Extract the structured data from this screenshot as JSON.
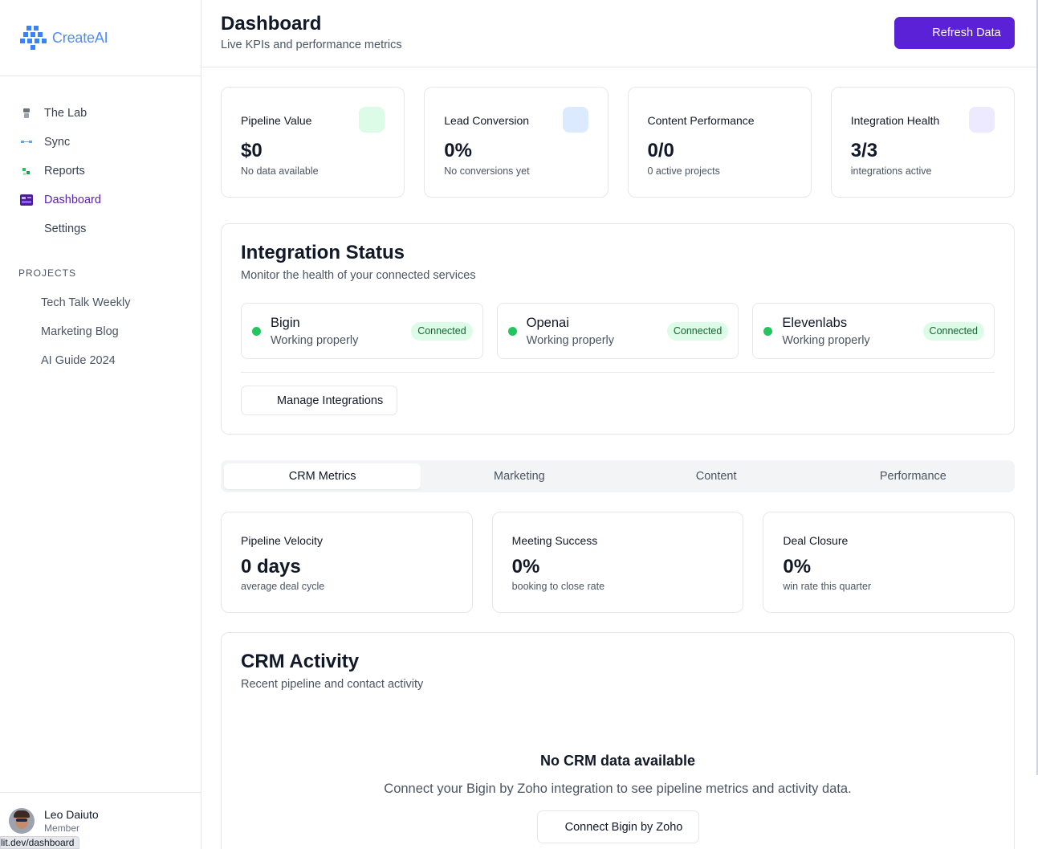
{
  "brand": {
    "name": "CreateAI",
    "color": "#3b82f6"
  },
  "sidebar": {
    "nav": [
      {
        "label": "The Lab",
        "icon": "lab-icon",
        "active": false
      },
      {
        "label": "Sync",
        "icon": "sync-icon",
        "active": false
      },
      {
        "label": "Reports",
        "icon": "reports-icon",
        "active": false
      },
      {
        "label": "Dashboard",
        "icon": "dashboard-icon",
        "active": true
      },
      {
        "label": "Settings",
        "icon": "",
        "active": false
      }
    ],
    "projects_title": "PROJECTS",
    "projects": [
      "Tech Talk Weekly",
      "Marketing Blog",
      "AI Guide 2024"
    ],
    "user": {
      "name": "Leo Daiuto",
      "role": "Member"
    },
    "status_url": "lit.dev/dashboard"
  },
  "header": {
    "title": "Dashboard",
    "subtitle": "Live KPIs and performance metrics",
    "refresh_label": "Refresh Data",
    "accent": "#5b21d6"
  },
  "kpis": [
    {
      "label": "Pipeline Value",
      "value": "$0",
      "note": "No data available",
      "swatch": "#dcfce7"
    },
    {
      "label": "Lead Conversion",
      "value": "0%",
      "note": "No conversions yet",
      "swatch": "#dbeafe"
    },
    {
      "label": "Content Performance",
      "value": "0/0",
      "note": "0 active projects",
      "swatch": ""
    },
    {
      "label": "Integration Health",
      "value": "3/3",
      "note": "integrations active",
      "swatch": "#ede9fe"
    }
  ],
  "integrations": {
    "title": "Integration Status",
    "subtitle": "Monitor the health of your connected services",
    "items": [
      {
        "name": "Bigin",
        "state": "Working properly",
        "badge": "Connected"
      },
      {
        "name": "Openai",
        "state": "Working properly",
        "badge": "Connected"
      },
      {
        "name": "Elevenlabs",
        "state": "Working properly",
        "badge": "Connected"
      }
    ],
    "manage_label": "Manage Integrations",
    "status_color": "#22c55e"
  },
  "tabs": [
    {
      "label": "CRM Metrics",
      "active": true
    },
    {
      "label": "Marketing",
      "active": false
    },
    {
      "label": "Content",
      "active": false
    },
    {
      "label": "Performance",
      "active": false
    }
  ],
  "metrics": [
    {
      "label": "Pipeline Velocity",
      "value": "0 days",
      "note": "average deal cycle"
    },
    {
      "label": "Meeting Success",
      "value": "0%",
      "note": "booking to close rate"
    },
    {
      "label": "Deal Closure",
      "value": "0%",
      "note": "win rate this quarter"
    }
  ],
  "crm_activity": {
    "title": "CRM Activity",
    "subtitle": "Recent pipeline and contact activity",
    "empty_title": "No CRM data available",
    "empty_desc": "Connect your Bigin by Zoho integration to see pipeline metrics and activity data.",
    "connect_label": "Connect Bigin by Zoho"
  }
}
